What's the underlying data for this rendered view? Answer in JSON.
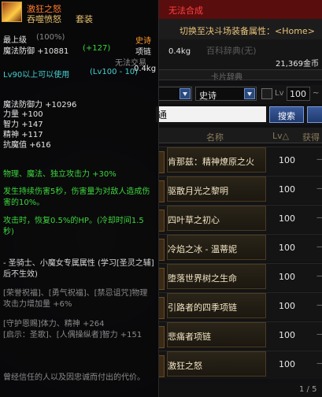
{
  "tooltip": {
    "item_name": "激狂之怒",
    "set_name": "吞噬愤怒",
    "set_type": "套装",
    "top_level": "最上级",
    "top_level_pct": "(100%)",
    "rarity": "史诗",
    "magic_def": "魔法防御 +10881",
    "magic_def_bonus": "(+127)",
    "slot_type": "项链",
    "untradeable": "无法交易",
    "weight": "0.4kg",
    "level_req": "Lv90以上可以使用",
    "level_range": "(Lv100 - 10)",
    "stats": [
      "魔法防御力 +10296",
      "力量 +100",
      "智力 +147",
      "精神 +117",
      "抗魔值 +616"
    ],
    "atk_line": "物理、魔法、独立攻击力 +30%",
    "effect_1": "发生持续伤害5秒，伤害量为对敌人造成伤害的10%。",
    "effect_2": "攻击时，恢复0.5%的HP。(冷却时间1.5秒)",
    "class_attr": "- 圣骑士、小魔女专属属性 (学习[圣灵之辅]后不生效)",
    "skill_attr": "[荣誉祝福]、[勇气祝福]、[禁忌诅咒]物理攻击力增加量 +6%",
    "support_attr": "[守护恩赐]体力、精神 +264\n[启示：圣歌]、[人偶操纵者]智力 +151",
    "flavor": "曾经信任的人以及因忠诚而付出的代价。"
  },
  "auction": {
    "warning": "无法合成",
    "switch_label": "切换至决斗场装备属性：<Home>",
    "weight": "0.4kg",
    "gold": "21,369金币",
    "faded_tab": "百科辞典(无)",
    "tab_other": "卡片辞典",
    "rarity_filter": "史诗",
    "lv_label": "Lv",
    "lv_value": "100",
    "lv_tilde": "~",
    "search_text": "通",
    "search_button": "搜索",
    "columns": {
      "name": "名称",
      "level": "Lv△",
      "obtain": "获得"
    },
    "rows": [
      {
        "name": "肯那兹：精神燎原之火",
        "level": "100",
        "obtain": "—"
      },
      {
        "name": "驱散月光之黎明",
        "level": "100",
        "obtain": "—"
      },
      {
        "name": "四叶草之初心",
        "level": "100",
        "obtain": "—"
      },
      {
        "name": "冷焰之冰 - 温蒂妮",
        "level": "100",
        "obtain": "—"
      },
      {
        "name": "堕落世界树之生命",
        "level": "100",
        "obtain": "—"
      },
      {
        "name": "引路者的四季项链",
        "level": "100",
        "obtain": "—"
      },
      {
        "name": "悲痛者项链",
        "level": "100",
        "obtain": "—"
      },
      {
        "name": "激狂之怒",
        "level": "100",
        "obtain": "—"
      }
    ],
    "pager": "1 / 5"
  }
}
